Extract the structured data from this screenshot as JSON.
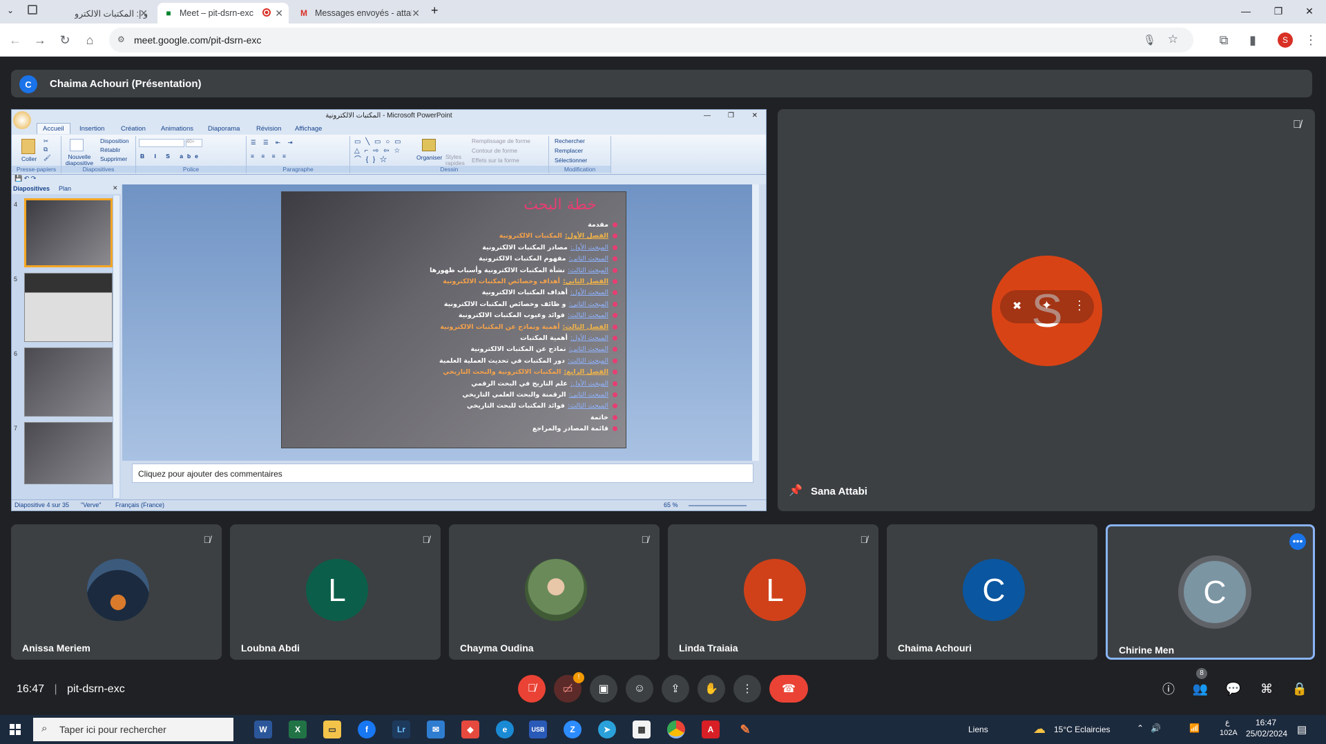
{
  "browser": {
    "tabs": [
      {
        "title": "و إ: المكتبات الالكترونية",
        "icon": "document-icon"
      },
      {
        "title": "Meet – pit-dsrn-exc",
        "icon": "meet-icon",
        "active": true
      },
      {
        "title": "Messages envoyés - attabi.sana",
        "icon": "gmail-icon"
      }
    ],
    "url": "meet.google.com/pit-dsrn-exc",
    "profile_letter": "S"
  },
  "meet": {
    "presenter_initial": "C",
    "presenter_label": "Chaima Achouri (Présentation)",
    "pinned_name": "Sana Attabi",
    "pinned_initial": "S",
    "participants": [
      {
        "name": "Anissa Meriem",
        "initial": "",
        "color": "#2b3a4a"
      },
      {
        "name": "Loubna Abdi",
        "initial": "L",
        "color": "#0b5f4a"
      },
      {
        "name": "Chayma Oudina",
        "initial": "",
        "color": "#6a8a5a"
      },
      {
        "name": "Linda Traiaia",
        "initial": "L",
        "color": "#d0411a"
      },
      {
        "name": "Chaima Achouri",
        "initial": "C",
        "color": "#0a56a0"
      },
      {
        "name": "Chirine Men",
        "initial": "C",
        "color": "#7b95a3"
      }
    ],
    "clock": "16:47",
    "meeting_code": "pit-dsrn-exc",
    "people_count": "8"
  },
  "ppt": {
    "title": "المكتبات الالكترونية - Microsoft PowerPoint",
    "tabs": [
      "Accueil",
      "Insertion",
      "Création",
      "Animations",
      "Diaporama",
      "Révision",
      "Affichage"
    ],
    "groups": {
      "clipboard": "Presse-papiers",
      "slides": "Diapositives",
      "font": "Police",
      "paragraph": "Paragraphe",
      "drawing": "Dessin",
      "editing": "Modification"
    },
    "ribbon": {
      "paste": "Coller",
      "new_slide": "Nouvelle diapositive",
      "layout": "Disposition",
      "reset": "Rétablir",
      "delete": "Supprimer",
      "font_size": "40+",
      "arrange": "Organiser",
      "quick_styles": "Styles rapides",
      "fill": "Remplissage de forme",
      "outline": "Contour de forme",
      "effects": "Effets sur la forme",
      "find": "Rechercher",
      "replace": "Remplacer",
      "select": "Sélectionner"
    },
    "pane_tabs": [
      "Diapositives",
      "Plan"
    ],
    "thumb_numbers": [
      "4",
      "5",
      "6",
      "7"
    ],
    "slide": {
      "title": "خطة البحث",
      "lines": [
        {
          "h": "",
          "t": "مقدمة"
        },
        {
          "h": "الفصل الأول:",
          "t": "المكتبات الالكترونية"
        },
        {
          "s": "المبحث الأول:",
          "t": "مصادر المكتبات الالكترونية"
        },
        {
          "s": "المبحث الثاني:",
          "t": "مفهوم المكتبات الالكترونية"
        },
        {
          "s": "المبحث الثالث:",
          "t": "نشأة المكتبات الالكترونية وأسباب ظهورها"
        },
        {
          "h": "الفصل الثاني:",
          "t": "أهداف وخصائص المكتبات الالكترونية"
        },
        {
          "s": "المبحث الأول:",
          "t": "أهداف المكتبات الالكترونية"
        },
        {
          "s": "المبحث الثاني:",
          "t": "و ظائف وخصائص المكتبات الالكترونية"
        },
        {
          "s": "المبحث الثالث:",
          "t": "فوائد وعيوب المكتبات الالكترونية"
        },
        {
          "h": "الفصل الثالث:",
          "t": "أهمية ونماذج عن المكتبات الالكترونية"
        },
        {
          "s": "المبحث الأول:",
          "t": "أهمية المكتبات"
        },
        {
          "s": "المبحث الثاني:",
          "t": "نماذج عن المكتبات الالكترونية"
        },
        {
          "s": "المبحث الثالث:",
          "t": "دور المكتبات في تحديث العملية العلمية"
        },
        {
          "h": "الفصل الرابع:",
          "t": "المكتبات الالكترونية والبحث التاريخي"
        },
        {
          "s": "المبحث الأول:",
          "t": "علم التاريخ في البحث الرقمي"
        },
        {
          "s": "المبحث الثاني:",
          "t": "الرقمنة والبحث العلمي التاريخي"
        },
        {
          "s": "المبحث الثالث:",
          "t": "فوائد المكتبات للبحث التاريخي"
        },
        {
          "h": "",
          "t": "خاتمة"
        },
        {
          "h": "",
          "t": "قائمة المصادر والمراجع"
        }
      ]
    },
    "notes_placeholder": "Cliquez pour ajouter des commentaires",
    "status": {
      "slide": "Diapositive 4 sur 35",
      "theme": "\"Verve\"",
      "lang": "Français (France)",
      "zoom": "65 %"
    }
  },
  "taskbar": {
    "search_placeholder": "Taper ici pour rechercher",
    "links": "Liens",
    "weather": "15°C  Eclaircies",
    "time": "16:47",
    "date": "25/02/2024",
    "kbd": "ع",
    "kbd2": "102A"
  },
  "colors": {
    "end_call": "#ea4335",
    "accent": "#8ab4f8"
  }
}
